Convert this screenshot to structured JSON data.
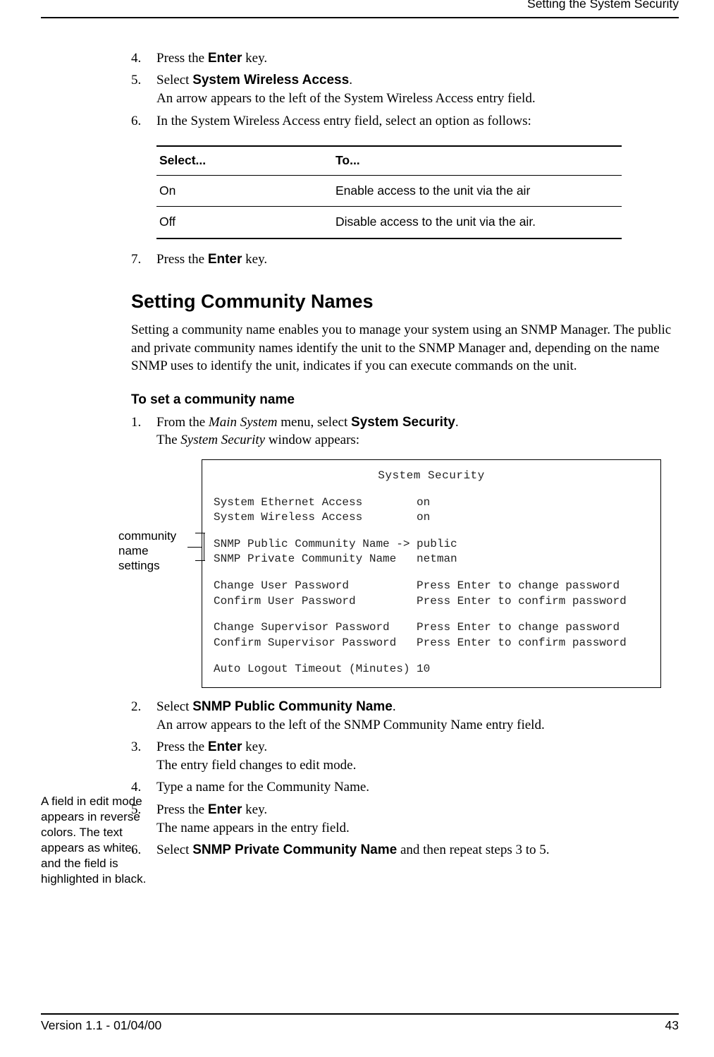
{
  "header": {
    "running": "Setting the System Security"
  },
  "steps_a": [
    {
      "num": "4.",
      "pre": "Press the ",
      "bold": "Enter",
      "post": " key."
    },
    {
      "num": "5.",
      "pre": "Select ",
      "bold": "System Wireless Access",
      "post": ".",
      "sub": "An arrow appears to the left of the System Wireless Access entry field."
    },
    {
      "num": "6.",
      "pre": "In the System Wireless Access entry field, select an option as follows:"
    }
  ],
  "table": {
    "th1": "Select...",
    "th2": "To...",
    "rows": [
      {
        "c1": "On",
        "c2": "Enable access to the unit via the air"
      },
      {
        "c1": "Off",
        "c2": "Disable access to the unit via the air."
      }
    ]
  },
  "step7": {
    "num": "7.",
    "pre": "Press the ",
    "bold": "Enter",
    "post": " key."
  },
  "section": {
    "title": "Setting Community Names",
    "body": "Setting a community name enables you to manage your system using an SNMP Manager. The public and private community names identify the unit to the SNMP Manager and, depending on the name SNMP uses to identify the unit, indicates if you can execute commands on the unit.",
    "subhead": "To set a community name"
  },
  "steps_b": [
    {
      "num": "1.",
      "pre": "From the ",
      "italic": "Main System",
      "mid": " menu, select ",
      "bold": "System Security",
      "post": ".",
      "sub_pre": "The ",
      "sub_italic": "System Security",
      "sub_post": " window appears:"
    }
  ],
  "callout": {
    "l1": "community",
    "l2": "name",
    "l3": "settings"
  },
  "shot": {
    "title": "System Security",
    "r1": "System Ethernet Access        on",
    "r2": "System Wireless Access        on",
    "r3": "SNMP Public Community Name -> public",
    "r4": "SNMP Private Community Name   netman",
    "r5": "Change User Password          Press Enter to change password",
    "r6": "Confirm User Password         Press Enter to confirm password",
    "r7": "Change Supervisor Password    Press Enter to change password",
    "r8": "Confirm Supervisor Password   Press Enter to confirm password",
    "r9": "Auto Logout Timeout (Minutes) 10"
  },
  "steps_c": [
    {
      "num": "2.",
      "pre": "Select ",
      "bold": "SNMP Public Community Name",
      "post": ".",
      "sub": "An arrow appears to the left of the SNMP Community Name entry field."
    },
    {
      "num": "3.",
      "pre": "Press the ",
      "bold": "Enter",
      "post": " key.",
      "sub": "The entry field changes to edit mode."
    },
    {
      "num": "4.",
      "pre": "Type a name for the Community Name."
    },
    {
      "num": "5.",
      "pre": "Press the ",
      "bold": "Enter",
      "post": " key.",
      "sub": "The name appears in the entry field."
    },
    {
      "num": "6.",
      "pre": "Select ",
      "bold": "SNMP Private Community Name",
      "post": " and then repeat steps 3 to 5."
    }
  ],
  "margin_note": "A field in edit mode appears in reverse colors. The text appears as white, and the field is highlighted in black.",
  "footer": {
    "left": "Version 1.1 - 01/04/00",
    "right": "43"
  }
}
